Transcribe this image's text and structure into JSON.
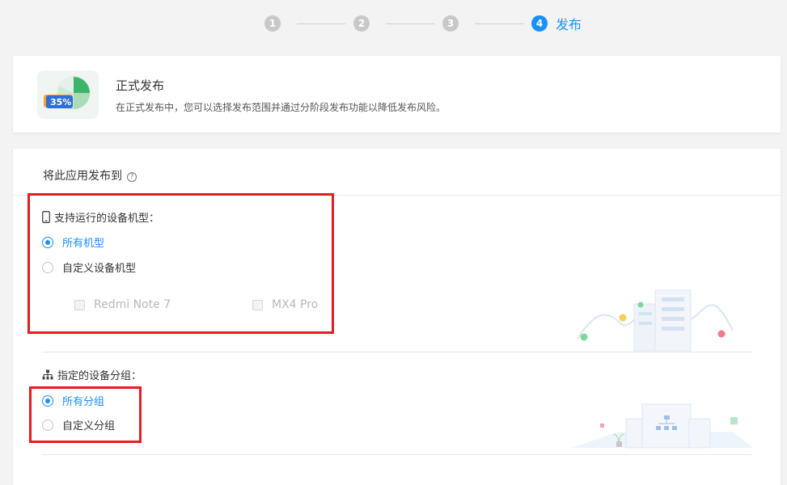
{
  "stepper": {
    "steps": [
      "1",
      "2",
      "3",
      "4"
    ],
    "active_label": "发布"
  },
  "hero": {
    "badge": "35%",
    "title": "正式发布",
    "desc": "在正式发布中，您可以选择发布范围并通过分阶段发布功能以降低发布风险。"
  },
  "main": {
    "header_title": "将此应用发布到",
    "header_help": "?",
    "devices": {
      "title": "支持运行的设备机型：",
      "options": [
        "所有机型",
        "自定义设备机型"
      ],
      "selected": 0,
      "models": [
        "Redmi Note 7",
        "MX4 Pro"
      ]
    },
    "groups": {
      "title": "指定的设备分组：",
      "options": [
        "所有分组",
        "自定义分组"
      ],
      "selected": 0
    }
  },
  "colors": {
    "accent": "#1890ff",
    "highlight": "#e51c23"
  }
}
